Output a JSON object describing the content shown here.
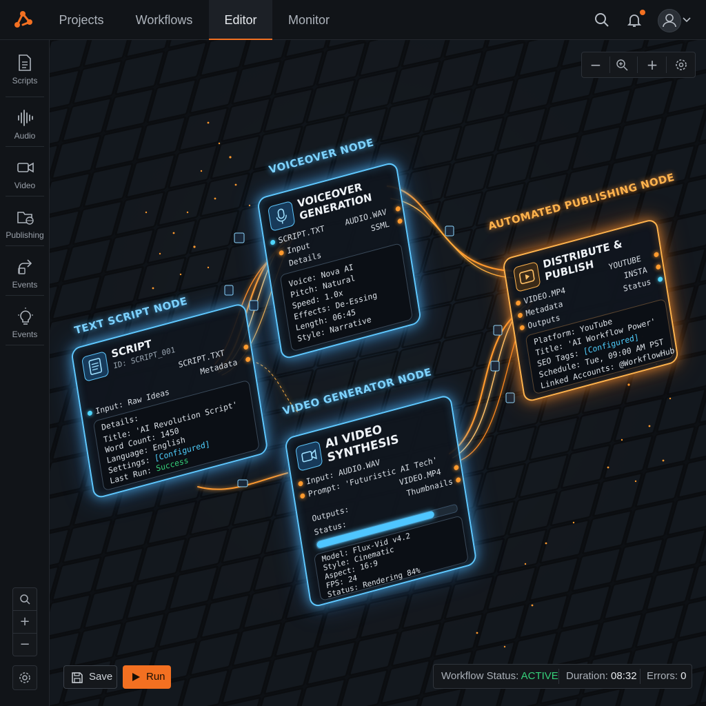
{
  "nav": {
    "tabs": [
      {
        "label": "Projects"
      },
      {
        "label": "Workflows"
      },
      {
        "label": "Editor"
      },
      {
        "label": "Monitor"
      }
    ],
    "active_tab": "Editor"
  },
  "sidebar": {
    "items": [
      {
        "label": "Scripts",
        "icon": "document-icon"
      },
      {
        "label": "Audio",
        "icon": "waveform-icon"
      },
      {
        "label": "Video",
        "icon": "video-camera-icon"
      },
      {
        "label": "Publishing",
        "icon": "folder-globe-icon"
      },
      {
        "label": "Events",
        "icon": "share-arrow-icon"
      },
      {
        "label": "Events",
        "icon": "lightbulb-icon"
      }
    ]
  },
  "nodes": {
    "script": {
      "tag": "TEXT SCRIPT NODE",
      "title": "SCRIPT",
      "id": "ID: SCRIPT_001",
      "output_1": "SCRIPT.TXT",
      "output_2": "Metadata",
      "input": "Input: Raw Ideas",
      "details_label": "Details:",
      "lines": [
        "Title: 'AI Revolution Script'",
        "Word Count: 1450",
        "Language: English"
      ],
      "settings_label": "Settings: ",
      "settings_value": "[Configured]",
      "last_run_label": "Last Run: ",
      "last_run_value": "Success"
    },
    "voiceover": {
      "tag": "VOICEOVER NODE",
      "title_1": "VOICEOVER",
      "title_2": "GENERATION",
      "input_1": "SCRIPT.TXT",
      "input_2": "Input",
      "input_3": "Details",
      "output_1": "AUDIO.WAV",
      "output_2": "SSML",
      "lines": [
        "Voice: Nova AI",
        "Pitch: Natural",
        "Speed: 1.0x",
        "Effects: De-Essing",
        "Length: 06:45",
        "Style: Narrative"
      ]
    },
    "video": {
      "tag": "VIDEO GENERATOR NODE",
      "title_1": "AI VIDEO",
      "title_2": "SYNTHESIS",
      "input_1": "Input: AUDIO.WAV",
      "input_2": "Prompt: 'Futuristic AI Tech'",
      "output_1": "VIDEO.MP4",
      "output_2": "Thumbnails",
      "outputs_label": "Outputs:",
      "status_label": "Status:",
      "progress": 0.84,
      "lines": [
        "Model: Flux-Vid v4.2",
        "Style: Cinematic",
        "Aspect: 16:9",
        "FPS: 24",
        "Status: Rendering 84%"
      ]
    },
    "publish": {
      "tag": "AUTOMATED PUBLISHING NODE",
      "title_1": "DISTRIBUTE &",
      "title_2": "PUBLISH",
      "input_1": "VIDEO.MP4",
      "input_2": "Metadata",
      "input_3": "Outputs",
      "output_1": "YOUTUBE",
      "output_2": "INSTA",
      "output_3": "Status",
      "lines": [
        "Platform: YouTube",
        "Title: 'AI Workflow Power'"
      ],
      "seo_label": "SEO Tags: ",
      "seo_value": "[Configured]",
      "lines_2": [
        "Schedule: Tue, 09:00 AM PST",
        "Linked Accounts: @WorkflowHub"
      ]
    }
  },
  "toolbar": {
    "save_label": "Save",
    "run_label": "Run"
  },
  "status": {
    "workflow_label": "Workflow Status: ",
    "workflow_value": "ACTIVE",
    "duration_label": "Duration: ",
    "duration_value": "08:32",
    "errors_label": "Errors: ",
    "errors_value": "0"
  },
  "colors": {
    "accent": "#f37021",
    "node_blue": "#5fc8ff",
    "node_orange": "#ffb34d",
    "active_green": "#36d07a"
  }
}
